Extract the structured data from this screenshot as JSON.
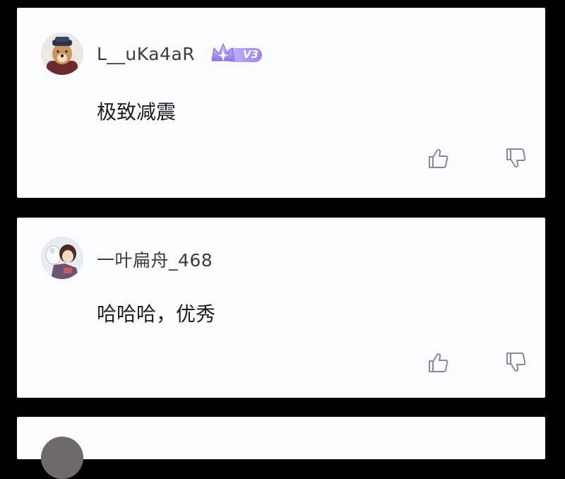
{
  "comments": [
    {
      "username": "L__uKa4aR",
      "vip_badge": "V3",
      "text": "极致减震",
      "avatar": "dog-avatar"
    },
    {
      "username": "一叶扁舟_468",
      "text": "哈哈哈，优秀",
      "avatar": "anime-couple-avatar"
    },
    {
      "avatar": "partial-avatar"
    }
  ],
  "icons": {
    "like": "thumbs-up-icon",
    "dislike": "thumbs-down-icon",
    "vip": "crown-badge-icon"
  },
  "colors": {
    "page_background": "#000000",
    "card_background": "#fcfbfd",
    "username_text": "#3d3d3d",
    "comment_text": "#1e1e1e",
    "icon_stroke": "#8a8a8e",
    "badge_purple": "#a58df0"
  }
}
